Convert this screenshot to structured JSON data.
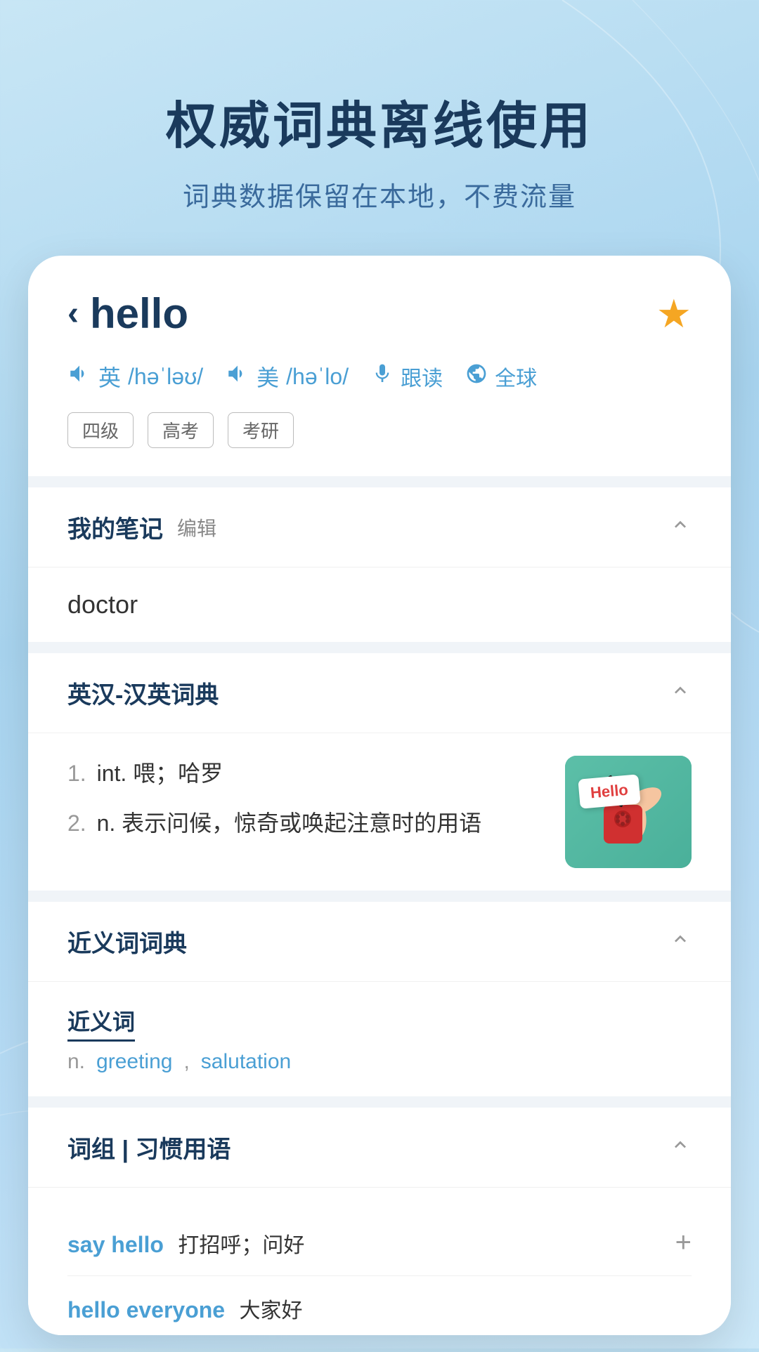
{
  "app": {
    "title": "权威词典离线使用",
    "subtitle": "词典数据保留在本地，不费流量"
  },
  "word": {
    "back_icon": "‹",
    "text": "hello",
    "star": "★",
    "uk_label": "英",
    "uk_phonetic": "/həˈləʊ/",
    "us_label": "美",
    "us_phonetic": "/həˈlo/",
    "follow_read": "跟读",
    "global": "全球",
    "tags": [
      "四级",
      "高考",
      "考研"
    ]
  },
  "notes_section": {
    "title": "我的笔记",
    "edit": "编辑",
    "content": "doctor",
    "chevron": "^"
  },
  "dict_section": {
    "title": "英汉-汉英词典",
    "chevron": "^",
    "definitions": [
      {
        "num": "1.",
        "pos": "int.",
        "text": "喂；哈罗"
      },
      {
        "num": "2.",
        "pos": "n.",
        "text": "表示问候，惊奇或唤起注意时的用语"
      }
    ]
  },
  "synonyms_section": {
    "title": "近义词词典",
    "chevron": "^",
    "label": "近义词",
    "pos": "n.",
    "words": [
      "greeting",
      "salutation"
    ]
  },
  "phrases_section": {
    "title": "词组 | 习惯用语",
    "chevron": "^",
    "items": [
      {
        "phrase": "say hello",
        "meaning": "打招呼；问好",
        "has_plus": true
      },
      {
        "phrase": "hello everyone",
        "meaning": "大家好",
        "has_plus": false
      }
    ]
  }
}
